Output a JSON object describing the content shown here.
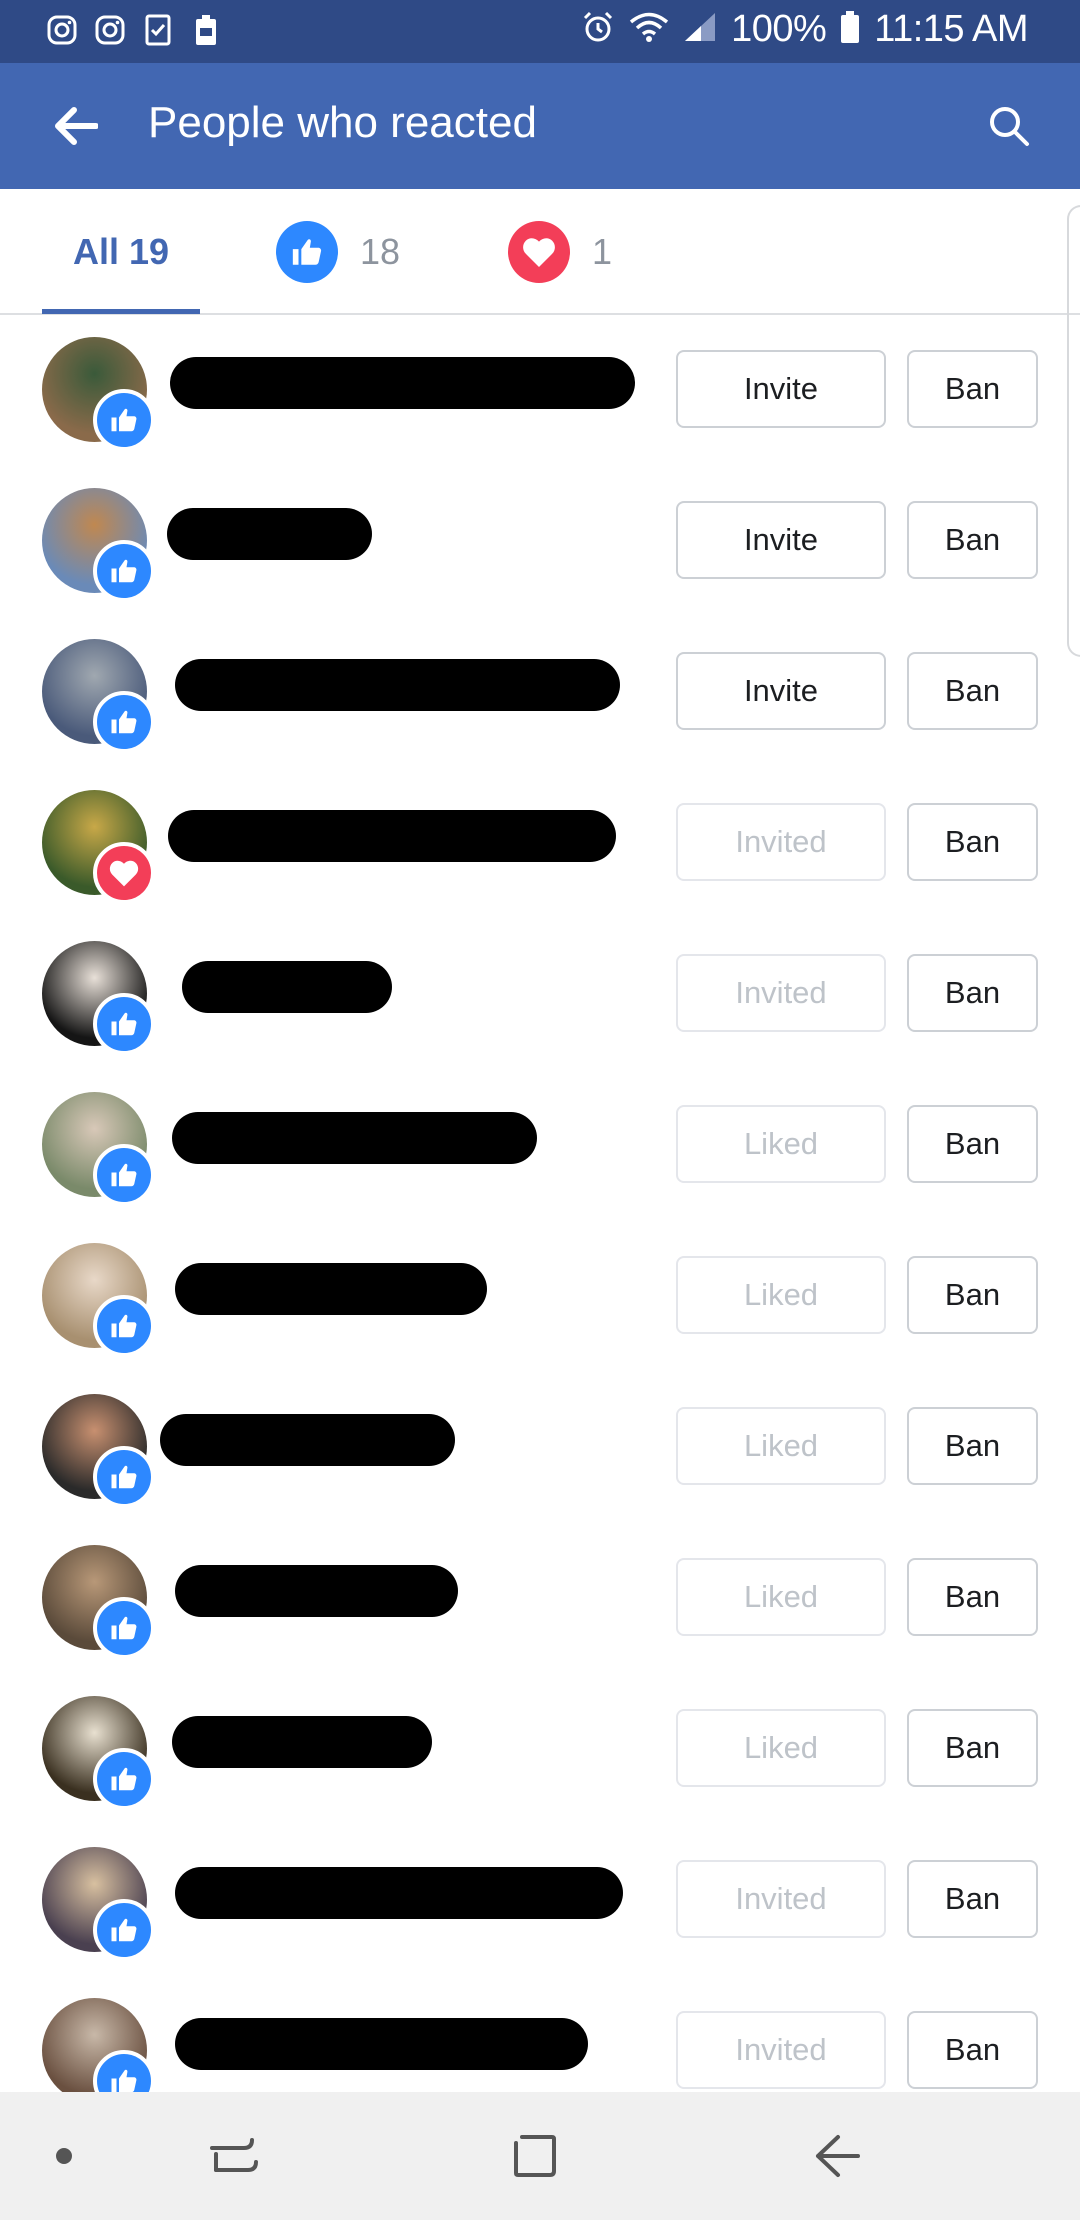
{
  "status_bar": {
    "battery_percent": "100%",
    "time": "11:15 AM",
    "left_icons": [
      "instagram-icon",
      "instagram-icon",
      "checklist-icon",
      "battery-saver-icon"
    ],
    "right_icons": [
      "alarm-icon",
      "wifi-icon",
      "signal-icon",
      "battery-icon"
    ]
  },
  "app_bar": {
    "title": "People who reacted",
    "color": "#4267b2"
  },
  "tabs": {
    "all_label": "All 19",
    "like_count": "18",
    "love_count": "1",
    "active_color": "#4267b2"
  },
  "colors": {
    "like": "#2d88ff",
    "love": "#f33e58"
  },
  "people": [
    {
      "reaction": "like",
      "action": "Invite",
      "action_enabled": true,
      "ban": "Ban",
      "name_redacted": true
    },
    {
      "reaction": "like",
      "action": "Invite",
      "action_enabled": true,
      "ban": "Ban",
      "name_redacted": true
    },
    {
      "reaction": "like",
      "action": "Invite",
      "action_enabled": true,
      "ban": "Ban",
      "name_redacted": true
    },
    {
      "reaction": "love",
      "action": "Invited",
      "action_enabled": false,
      "ban": "Ban",
      "name_redacted": true
    },
    {
      "reaction": "like",
      "action": "Invited",
      "action_enabled": false,
      "ban": "Ban",
      "name_redacted": true
    },
    {
      "reaction": "like",
      "action": "Liked",
      "action_enabled": false,
      "ban": "Ban",
      "name_redacted": true
    },
    {
      "reaction": "like",
      "action": "Liked",
      "action_enabled": false,
      "ban": "Ban",
      "name_redacted": true
    },
    {
      "reaction": "like",
      "action": "Liked",
      "action_enabled": false,
      "ban": "Ban",
      "name_redacted": true
    },
    {
      "reaction": "like",
      "action": "Liked",
      "action_enabled": false,
      "ban": "Ban",
      "name_redacted": true
    },
    {
      "reaction": "like",
      "action": "Liked",
      "action_enabled": false,
      "ban": "Ban",
      "name_redacted": true
    },
    {
      "reaction": "like",
      "action": "Invited",
      "action_enabled": false,
      "ban": "Ban",
      "name_redacted": true
    },
    {
      "reaction": "like",
      "action": "Invited",
      "action_enabled": false,
      "ban": "Ban",
      "name_redacted": true
    }
  ],
  "nav_bar": {
    "buttons": [
      "nav-dot",
      "recent-apps-icon",
      "home-icon",
      "back-icon"
    ]
  }
}
